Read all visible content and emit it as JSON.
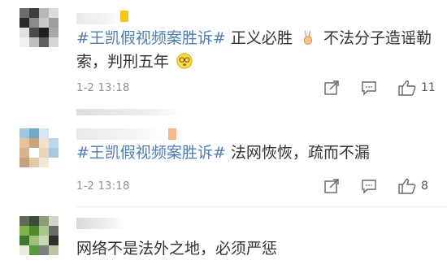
{
  "comments": [
    {
      "hashtag": "#王凯假视频案胜诉#",
      "text_a": "正义必胜",
      "emoji_a": "victory-hand-emoji",
      "text_b": "不法分子造谣勒索，判刑五年",
      "emoji_b": "dizzy-face-emoji",
      "time": "1-2 13:18",
      "likes": "11"
    },
    {
      "hashtag": "#王凯假视频案胜诉#",
      "text_a": "法网恢恢，疏而不漏",
      "time": "1-2 13:18",
      "likes": "8"
    },
    {
      "text_a": "网络不是法外之地，必须严惩"
    }
  ],
  "colors": {
    "hashtag": "#507daf",
    "text": "#333333",
    "meta": "#8f8f8f",
    "accent_yellow": "#f5c518"
  }
}
